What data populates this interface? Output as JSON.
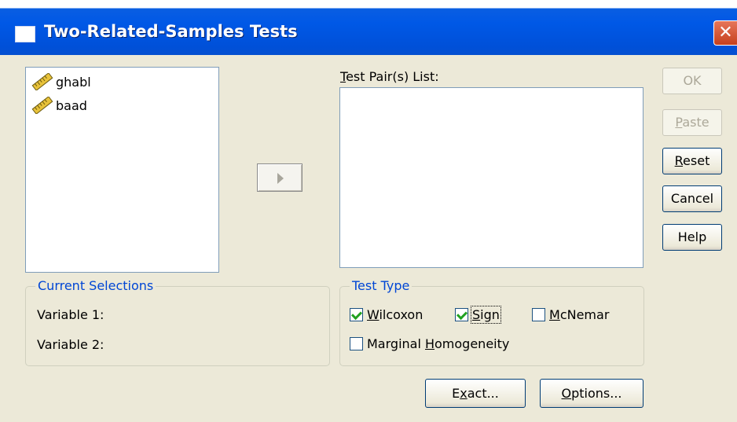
{
  "window": {
    "title": "Two-Related-Samples Tests",
    "close_glyph": "✕"
  },
  "variables": [
    {
      "name": "ghabl",
      "icon": "ruler-icon"
    },
    {
      "name": "baad",
      "icon": "ruler-icon"
    }
  ],
  "move_button_icon": "triangle-right-icon",
  "test_pair_list": {
    "label_prefix": "T",
    "label_rest": "est Pair(s) List:",
    "items": []
  },
  "buttons": {
    "ok": "OK",
    "paste_prefix": "P",
    "paste_rest": "aste",
    "reset_prefix": "R",
    "reset_rest": "eset",
    "cancel": "Cancel",
    "help": "Help",
    "exact_pre": "E",
    "exact_u": "x",
    "exact_post": "act...",
    "options_u": "O",
    "options_rest": "ptions..."
  },
  "current_selections": {
    "legend": "Current Selections",
    "variable1_label": "Variable 1:",
    "variable2_label": "Variable 2:"
  },
  "test_type": {
    "legend": "Test Type",
    "wilcoxon_u": "W",
    "wilcoxon_rest": "ilcoxon",
    "wilcoxon_checked": true,
    "sign_u": "S",
    "sign_rest": "ign",
    "sign_checked": true,
    "mcnemar_u": "M",
    "mcnemar_rest": "cNemar",
    "mcnemar_checked": false,
    "marginal_pre": "Marginal ",
    "marginal_u": "H",
    "marginal_rest": "omogeneity",
    "marginal_checked": false
  },
  "colors": {
    "titlebar": "#0058e6",
    "dialog_bg": "#ece9d8",
    "group_legend": "#0046d5",
    "check": "#21a121"
  }
}
